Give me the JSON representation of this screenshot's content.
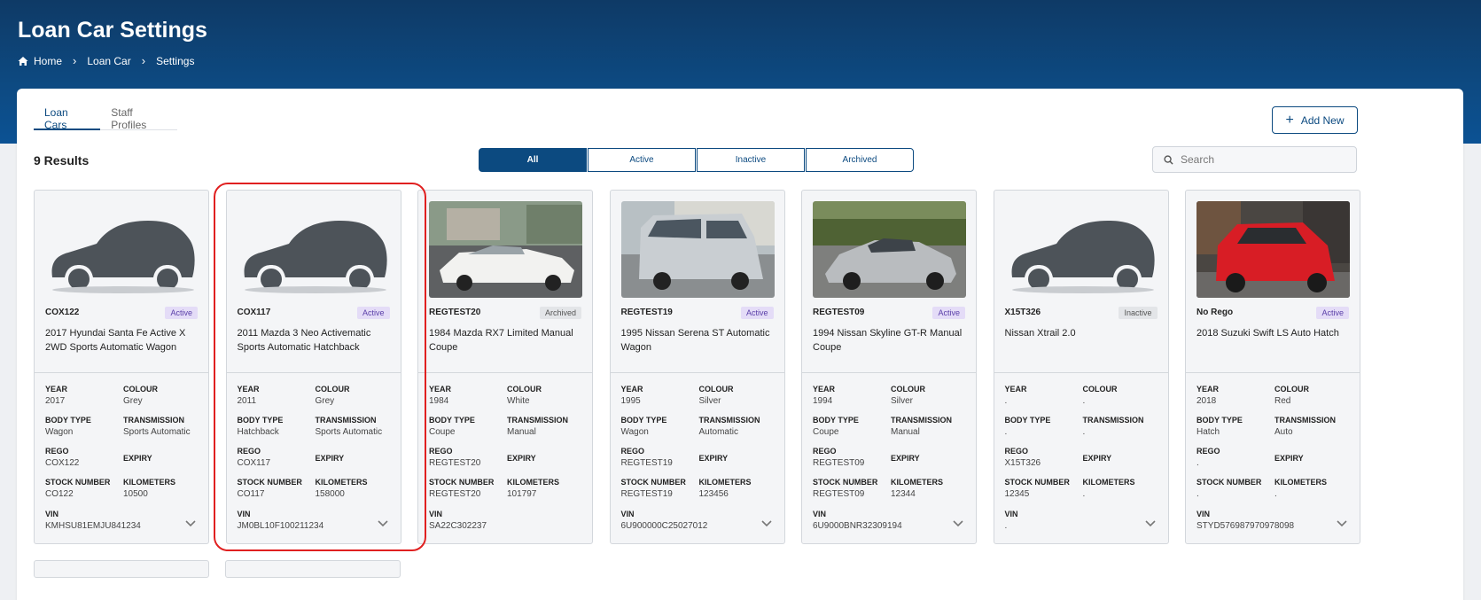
{
  "page": {
    "title": "Loan Car Settings",
    "breadcrumb": [
      "Home",
      "Loan Car",
      "Settings"
    ]
  },
  "tabs": [
    "Loan Cars",
    "Staff Profiles"
  ],
  "add_button": "Add New",
  "results": "9 Results",
  "filters": [
    "All",
    "Active",
    "Inactive",
    "Archived"
  ],
  "search": {
    "placeholder": "Search"
  },
  "labels": {
    "year": "YEAR",
    "colour": "COLOUR",
    "body_type": "BODY TYPE",
    "transmission": "TRANSMISSION",
    "rego": "REGO",
    "expiry": "EXPIRY",
    "stock_number": "STOCK NUMBER",
    "kilometers": "KILOMETERS",
    "vin": "VIN"
  },
  "colors": {
    "primary": "#0c4a80",
    "highlight": "#e02020"
  },
  "cars": [
    {
      "rego": "COX122",
      "status": "Active",
      "name": "2017 Hyundai Santa Fe Active X 2WD Sports Automatic Wagon",
      "year": "2017",
      "colour": "Grey",
      "body_type": "Wagon",
      "transmission": "Sports Automatic",
      "rego_val": "COX122",
      "expiry": "",
      "stock_number": "CO122",
      "kilometers": "10500",
      "vin": "KMHSU81EMJU841234",
      "image": "placeholder",
      "chevron": true
    },
    {
      "rego": "COX117",
      "status": "Active",
      "name": "2011 Mazda 3 Neo Activematic Sports Automatic Hatchback",
      "year": "2011",
      "colour": "Grey",
      "body_type": "Hatchback",
      "transmission": "Sports Automatic",
      "rego_val": "COX117",
      "expiry": "",
      "stock_number": "CO117",
      "kilometers": "158000",
      "vin": "JM0BL10F100211234",
      "image": "placeholder",
      "chevron": true
    },
    {
      "rego": "REGTEST20",
      "status": "Archived",
      "name": "1984 Mazda RX7 Limited Manual Coupe",
      "year": "1984",
      "colour": "White",
      "body_type": "Coupe",
      "transmission": "Manual",
      "rego_val": "REGTEST20",
      "expiry": "",
      "stock_number": "REGTEST20",
      "kilometers": "101797",
      "vin": "SA22C302237",
      "image": "white-coupe",
      "chevron": false
    },
    {
      "rego": "REGTEST19",
      "status": "Active",
      "name": "1995 Nissan Serena ST Automatic Wagon",
      "year": "1995",
      "colour": "Silver",
      "body_type": "Wagon",
      "transmission": "Automatic",
      "rego_val": "REGTEST19",
      "expiry": "",
      "stock_number": "REGTEST19",
      "kilometers": "123456",
      "vin": "6U900000C25027012",
      "image": "silver-van",
      "chevron": true
    },
    {
      "rego": "REGTEST09",
      "status": "Active",
      "name": "1994 Nissan Skyline GT-R Manual Coupe",
      "year": "1994",
      "colour": "Silver",
      "body_type": "Coupe",
      "transmission": "Manual",
      "rego_val": "REGTEST09",
      "expiry": "",
      "stock_number": "REGTEST09",
      "kilometers": "12344",
      "vin": "6U9000BNR32309194",
      "image": "silver-coupe",
      "chevron": true
    },
    {
      "rego": "X15T326",
      "status": "Inactive",
      "name": "Nissan Xtrail 2.0",
      "year": ".",
      "colour": ".",
      "body_type": ".",
      "transmission": ".",
      "rego_val": "X15T326",
      "expiry": "",
      "stock_number": "12345",
      "kilometers": ".",
      "vin": ".",
      "image": "placeholder",
      "chevron": true
    },
    {
      "rego": "No Rego",
      "status": "Active",
      "name": "2018 Suzuki Swift LS Auto Hatch",
      "year": "2018",
      "colour": "Red",
      "body_type": "Hatch",
      "transmission": "Auto",
      "rego_val": ".",
      "expiry": "",
      "stock_number": ".",
      "kilometers": ".",
      "vin": "STYD576987970978098",
      "image": "red-hatch",
      "chevron": true
    }
  ]
}
